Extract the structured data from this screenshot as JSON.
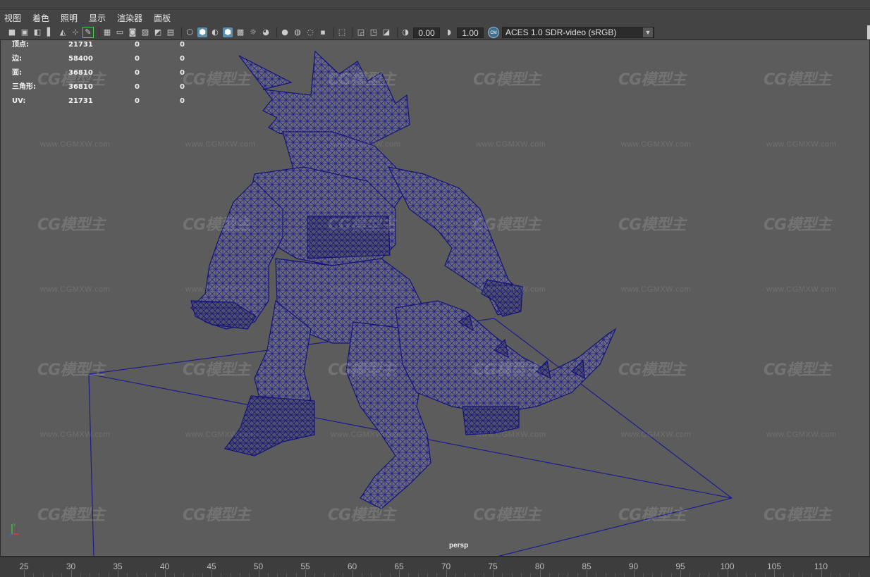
{
  "menubar": {
    "items": [
      "视图",
      "着色",
      "照明",
      "显示",
      "渲染器",
      "面板"
    ]
  },
  "toolbar": {
    "exposure": "0.00",
    "gamma": "1.00",
    "cm_badge": "CM",
    "color_space": "ACES 1.0 SDR-video (sRGB)",
    "icons": [
      "camera-icon",
      "camera-lock-icon",
      "camera-attributes-icon",
      "bookmark-icon",
      "image-plane-icon",
      "2d-pan-zoom-icon",
      "grease-pencil-icon",
      "grid-icon",
      "film-gate-icon",
      "resolution-gate-icon",
      "gate-mask-icon",
      "field-chart-icon",
      "safe-action-icon",
      "safe-title-icon",
      "wireframe-icon",
      "smooth-shade-icon",
      "default-material-icon",
      "wireframe-on-shaded-icon",
      "xray-icon",
      "use-lights-icon",
      "shadows-icon",
      "screen-space-ao-icon",
      "motion-blur-icon",
      "multisample-aa-icon",
      "depth-of-field-icon",
      "isolate-select-icon",
      "xray-joints-icon",
      "xray-active-icon",
      "backface-cull-icon",
      "exposure-icon",
      "gamma-icon"
    ]
  },
  "hud": {
    "rows": [
      {
        "label": "顶点:",
        "v1": "21731",
        "v2": "0",
        "v3": "0"
      },
      {
        "label": "边:",
        "v1": "58400",
        "v2": "0",
        "v3": "0"
      },
      {
        "label": "面:",
        "v1": "36810",
        "v2": "0",
        "v3": "0"
      },
      {
        "label": "三角形:",
        "v1": "36810",
        "v2": "0",
        "v3": "0"
      },
      {
        "label": "UV:",
        "v1": "21731",
        "v2": "0",
        "v3": "0"
      }
    ]
  },
  "viewport": {
    "camera_label": "persp",
    "watermark_logo": "CG模型主",
    "watermark_url": "www.CGMXW.com",
    "background": "#5c5c5c",
    "wire_color": "#1c1c8c"
  },
  "ruler": {
    "labels": [
      "25",
      "30",
      "35",
      "40",
      "45",
      "50",
      "55",
      "60",
      "65",
      "70",
      "75",
      "80",
      "85",
      "90",
      "95",
      "100",
      "105",
      "110"
    ]
  }
}
